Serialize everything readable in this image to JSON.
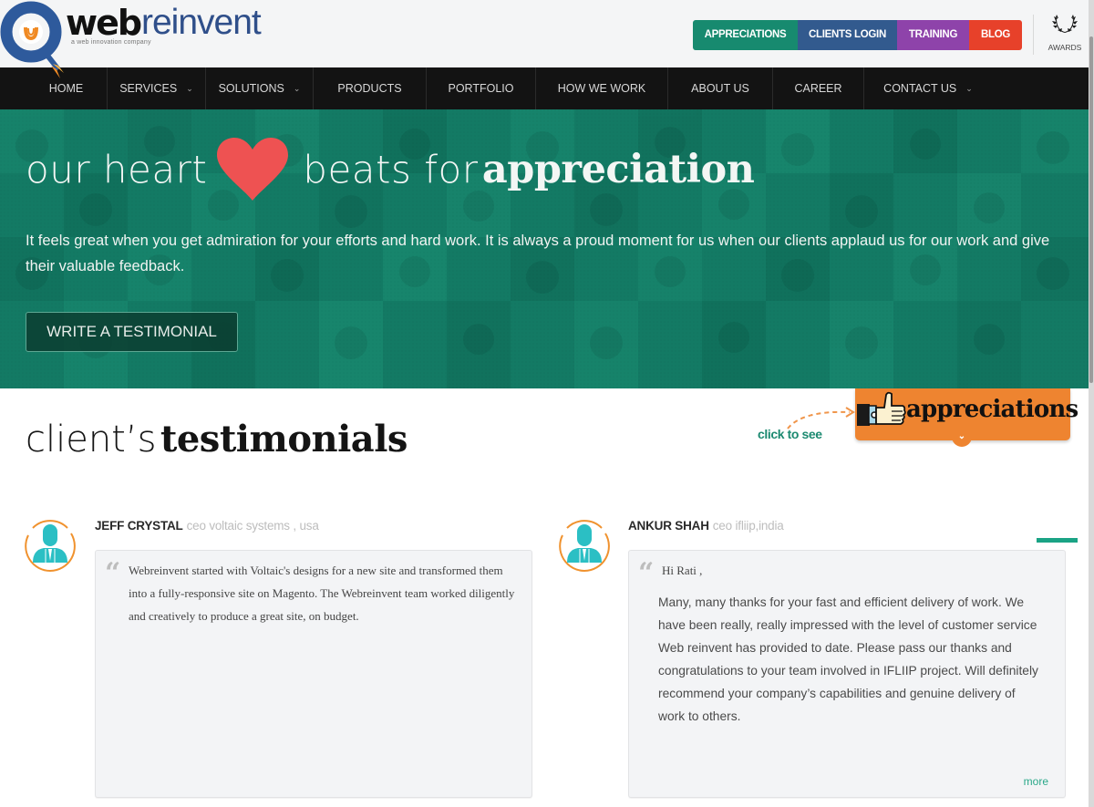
{
  "header": {
    "logo": {
      "brand_bold": "web",
      "brand_light": "reinvent",
      "tagline": "a web innovation company"
    },
    "top_buttons": [
      {
        "label": "APPRECIATIONS",
        "color": "#178a6f"
      },
      {
        "label": "CLIENTS LOGIN",
        "color": "#325a8e"
      },
      {
        "label": "TRAINING",
        "color": "#8e43aa"
      },
      {
        "label": "BLOG",
        "color": "#e7412a"
      }
    ],
    "awards": {
      "label": "AWARDS",
      "icon": "laurel-wreath-icon"
    }
  },
  "nav": {
    "items": [
      {
        "label": "HOME",
        "has_dropdown": false
      },
      {
        "label": "SERVICES",
        "has_dropdown": true
      },
      {
        "label": "SOLUTIONS",
        "has_dropdown": true
      },
      {
        "label": "PRODUCTS",
        "has_dropdown": false
      },
      {
        "label": "PORTFOLIO",
        "has_dropdown": false
      },
      {
        "label": "HOW WE WORK",
        "has_dropdown": false
      },
      {
        "label": "ABOUT US",
        "has_dropdown": false
      },
      {
        "label": "CAREER",
        "has_dropdown": false
      },
      {
        "label": "CONTACT US",
        "has_dropdown": true
      }
    ],
    "caret": "⌄"
  },
  "hero": {
    "title_prefix": "our heart",
    "title_middle": "beats for",
    "title_bold": "appreciation",
    "heart_color": "#ee5252",
    "text": "It feels great when you get admiration for your efforts and hard work. It is always a proud moment for us when our clients applaud us for our work and give their valuable feedback.",
    "cta_label": "WRITE A TESTIMONIAL",
    "background_color": "#137a64"
  },
  "testimonials": {
    "title_light": "client’s",
    "title_bold": "testimonials",
    "click_hint": "click to see",
    "badge_label": "appreciations",
    "badge_color": "#ee8430",
    "badge_chevron": "⌄",
    "quote_glyph": "“",
    "items": [
      {
        "name": "JEFF CRYSTAL",
        "role": "ceo voltaic systems , usa",
        "text": "Webreinvent started with Voltaic's designs for a new site and transformed them into a fully-responsive site on Magento. The Webreinvent team worked diligently and creatively to produce a great site, on budget."
      },
      {
        "name": "ANKUR SHAH",
        "role": "ceo ifliip,india",
        "greeting": "Hi Rati ,",
        "text": "Many, many thanks for your fast and efficient delivery of work. We have been really, really impressed with the level of customer service Web reinvent has provided to date. Please pass our thanks and congratulations to your team involved in IFLIIP project. Will definitely recommend your company’s capabilities and genuine delivery of work to others.",
        "more_label": "more"
      }
    ]
  }
}
